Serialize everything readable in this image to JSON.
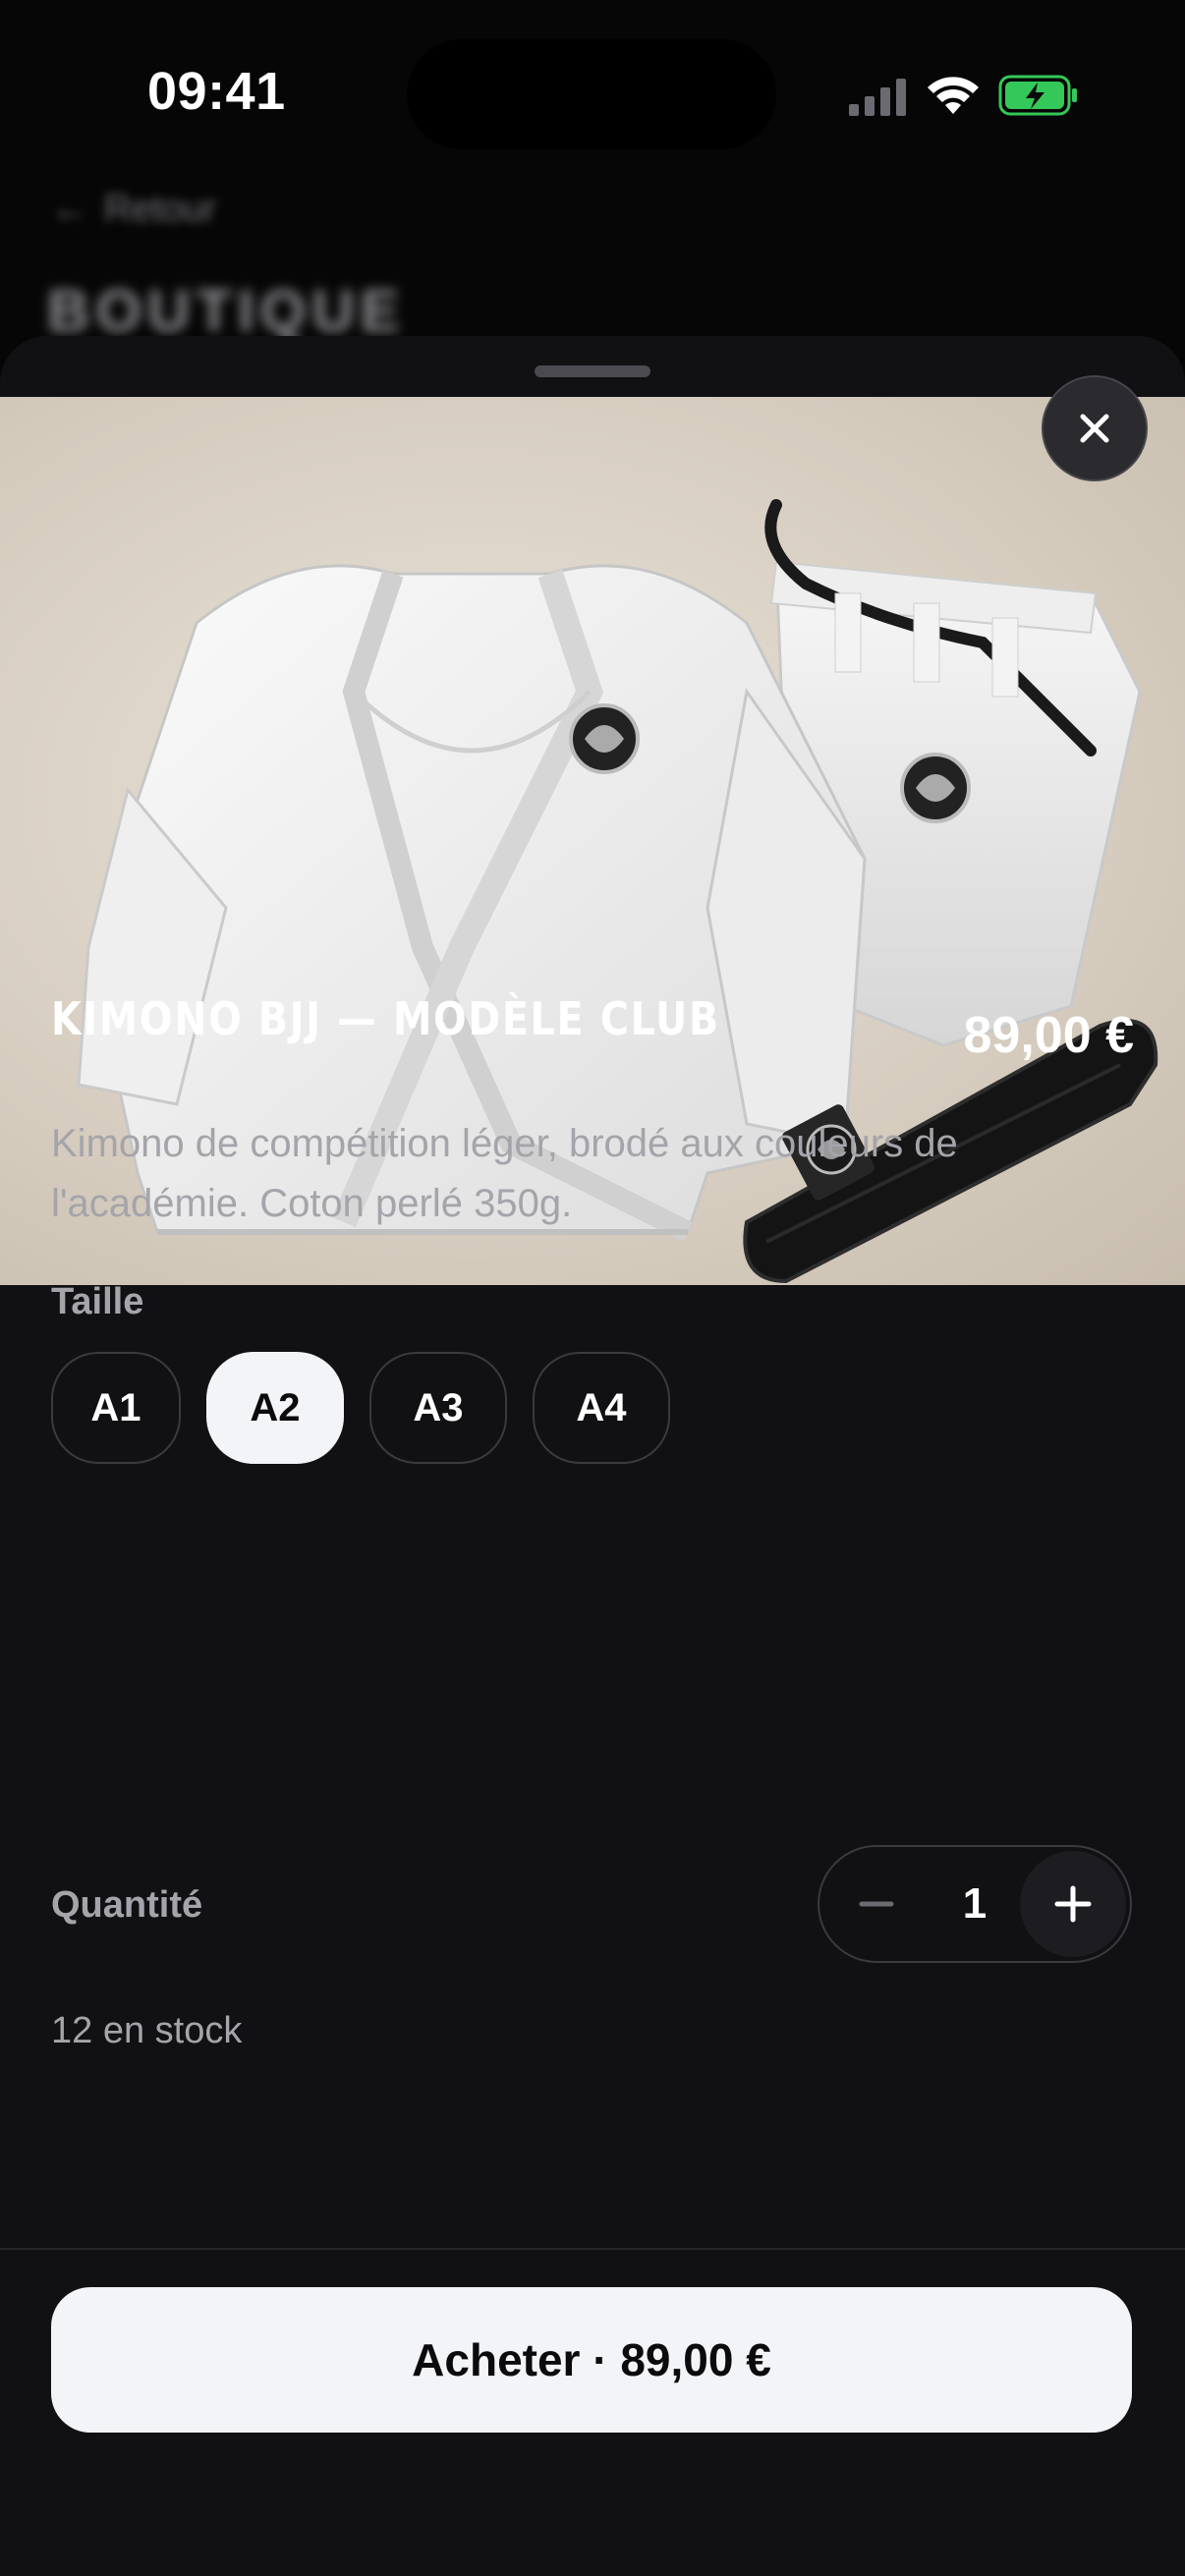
{
  "status_bar": {
    "time": "09:41"
  },
  "background_page": {
    "back_label": "Retour",
    "title": "BOUTIQUE"
  },
  "product": {
    "image_icon": "kimono-photo",
    "title": "KIMONO BJJ — MODÈLE CLUB",
    "price": "89,00 €",
    "description": "Kimono de compétition léger, brodé aux couleurs de l'académie. Coton perlé 350g.",
    "size_label": "Taille",
    "sizes": [
      {
        "label": "A1",
        "selected": false
      },
      {
        "label": "A2",
        "selected": true
      },
      {
        "label": "A3",
        "selected": false
      },
      {
        "label": "A4",
        "selected": false
      }
    ],
    "quantity_label": "Quantité",
    "quantity": "1",
    "stock": "12 en stock"
  },
  "actions": {
    "buy_label": "Acheter · 89,00 €"
  },
  "colors": {
    "background": "#060607",
    "sheet": "#111114",
    "accent_light": "#f3f4f8",
    "muted_text": "#a4a4aa",
    "battery_green": "#34c759"
  }
}
